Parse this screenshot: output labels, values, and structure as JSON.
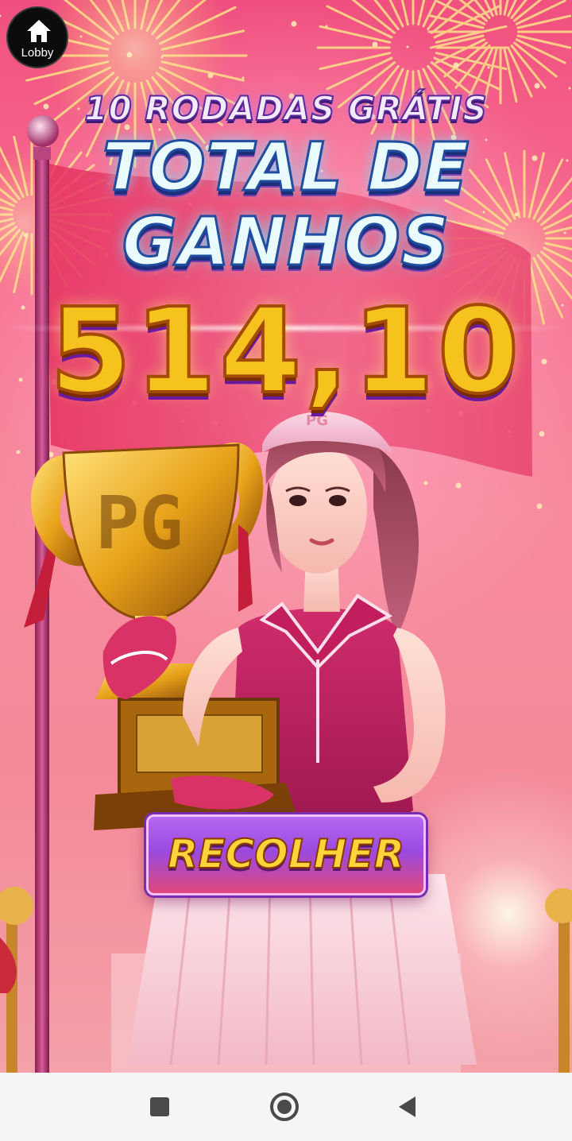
{
  "lobby": {
    "label": "Lobby",
    "icon": "home-icon"
  },
  "win_screen": {
    "free_spins_label": "10 RODADAS GRÁTIS",
    "title_line_1": "TOTAL DE",
    "title_line_2": "GANHOS",
    "total_win": "514,10",
    "collect_button_label": "RECOLHER"
  },
  "artwork": {
    "trophy_lettering": "PG",
    "visor_lettering": "PG"
  },
  "nav_bar": {
    "icons": [
      "recents-square-icon",
      "home-circle-icon",
      "back-triangle-icon"
    ]
  },
  "colors": {
    "background_pink": "#f0507f",
    "amount_gold": "#f6c21e",
    "title_cyan": "#e9fbff",
    "button_purple": "#9a4ae0",
    "button_label_yellow": "#ffd43a",
    "nav_bar_bg": "#f4f5f4"
  }
}
